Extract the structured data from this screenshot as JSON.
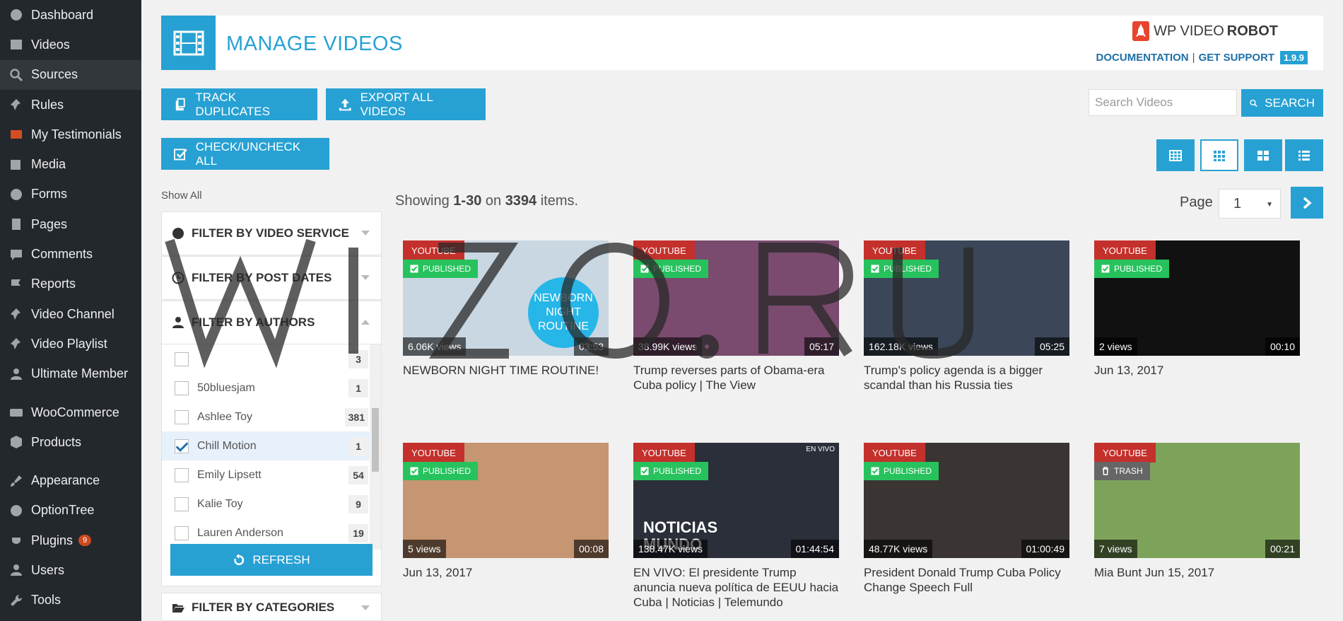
{
  "sidebar": {
    "items": [
      {
        "label": "Dashboard",
        "icon": "dashboard-icon"
      },
      {
        "label": "Videos",
        "icon": "video-icon"
      },
      {
        "label": "Sources",
        "icon": "search-icon",
        "active": true
      },
      {
        "label": "Rules",
        "icon": "pin-icon"
      },
      {
        "label": "My Testimonials",
        "icon": "quote-icon"
      },
      {
        "label": "Media",
        "icon": "media-icon"
      },
      {
        "label": "Forms",
        "icon": "forms-icon"
      },
      {
        "label": "Pages",
        "icon": "pages-icon"
      },
      {
        "label": "Comments",
        "icon": "comment-icon"
      },
      {
        "label": "Reports",
        "icon": "flag-icon"
      },
      {
        "label": "Video Channel",
        "icon": "pin-icon"
      },
      {
        "label": "Video Playlist",
        "icon": "pin-icon"
      },
      {
        "label": "Ultimate Member",
        "icon": "user-icon"
      },
      {
        "label": "WooCommerce",
        "icon": "woo-icon"
      },
      {
        "label": "Products",
        "icon": "box-icon"
      },
      {
        "label": "Appearance",
        "icon": "brush-icon"
      },
      {
        "label": "OptionTree",
        "icon": "optiontree-icon"
      },
      {
        "label": "Plugins",
        "icon": "plug-icon",
        "badge": "9"
      },
      {
        "label": "Users",
        "icon": "user-icon"
      },
      {
        "label": "Tools",
        "icon": "wrench-icon"
      }
    ]
  },
  "header": {
    "title": "MANAGE VIDEOS",
    "brand_light": "WP VIDEO",
    "brand_bold": "ROBOT",
    "documentation": "DOCUMENTATION",
    "support": "GET SUPPORT",
    "separator": "|",
    "version": "1.9.9"
  },
  "toolbar": {
    "track_duplicates": "TRACK DUPLICATES",
    "export_all": "EXPORT ALL VIDEOS",
    "check_uncheck": "CHECK/UNCHECK ALL",
    "search_placeholder": "Search Videos",
    "search_button": "SEARCH"
  },
  "list": {
    "show_all": "Show All",
    "showing_prefix": "Showing",
    "range": "1-30",
    "on": "on",
    "total": "3394",
    "items_suffix": "items.",
    "page_label": "Page",
    "page_value": "1"
  },
  "filters": {
    "video_service": "FILTER BY VIDEO SERVICE",
    "post_dates": "FILTER BY POST DATES",
    "authors": "FILTER BY AUTHORS",
    "categories": "FILTER BY CATEGORIES",
    "refresh": "REFRESH",
    "author_rows": [
      {
        "name": "",
        "count": "3",
        "checked": false
      },
      {
        "name": "50bluesjam",
        "count": "1",
        "checked": false
      },
      {
        "name": "Ashlee Toy",
        "count": "381",
        "checked": false
      },
      {
        "name": "Chill Motion",
        "count": "1",
        "checked": true
      },
      {
        "name": "Emily Lipsett",
        "count": "54",
        "checked": false
      },
      {
        "name": "Kalie Toy",
        "count": "9",
        "checked": false
      },
      {
        "name": "Lauren Anderson",
        "count": "19",
        "checked": false
      }
    ]
  },
  "videos": [
    {
      "service": "YOUTUBE",
      "status": "PUBLISHED",
      "views": "6.06K views",
      "duration": "03:53",
      "title": "NEWBORN NIGHT TIME ROUTINE!",
      "thumb_text": "NEWBORN NIGHT ROUTINE",
      "bg": "#c9d7e2"
    },
    {
      "service": "YOUTUBE",
      "status": "PUBLISHED",
      "views": "38.99K views",
      "duration": "05:17",
      "title": "Trump reverses parts of Obama-era Cuba policy | The View",
      "bg": "#7a4b6e"
    },
    {
      "service": "YOUTUBE",
      "status": "PUBLISHED",
      "views": "162.18K views",
      "duration": "05:25",
      "title": "Trump's policy agenda is a bigger scandal than his Russia ties",
      "bg": "#3b4658"
    },
    {
      "service": "YOUTUBE",
      "status": "PUBLISHED",
      "views": "2 views",
      "duration": "00:10",
      "title": "Jun 13, 2017",
      "bg": "#111111"
    },
    {
      "service": "YOUTUBE",
      "status": "PUBLISHED",
      "views": "5 views",
      "duration": "00:08",
      "title": "Jun 13, 2017",
      "bg": "#c69572"
    },
    {
      "service": "YOUTUBE",
      "status": "PUBLISHED",
      "views": "138.47K views",
      "duration": "01:44:54",
      "title": "EN VIVO: El presidente Trump anuncia nueva política de EEUU hacia Cuba | Noticias | Telemundo",
      "thumb_text": "NOTICIAS MUNDO",
      "corner_text": "EN VIVO",
      "bg": "#2b2f3a"
    },
    {
      "service": "YOUTUBE",
      "status": "PUBLISHED",
      "views": "48.77K views",
      "duration": "01:00:49",
      "title": "President Donald Trump Cuba Policy Change Speech Full",
      "bg": "#3a3533"
    },
    {
      "service": "YOUTUBE",
      "status": "TRASH",
      "views": "7 views",
      "duration": "00:21",
      "title": "Mia Bunt Jun 15, 2017",
      "bg": "#7da35a"
    }
  ],
  "colors": {
    "accent": "#27a1d3",
    "youtube": "#c4302b",
    "published": "#27c25d",
    "trash": "#666666",
    "sidebar": "#23282d"
  }
}
